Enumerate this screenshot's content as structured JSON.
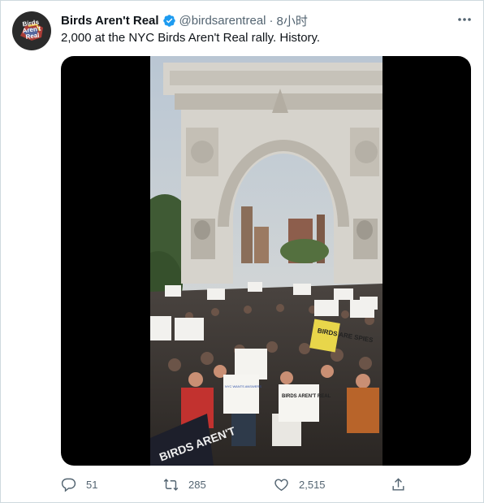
{
  "avatar": {
    "logo_text": [
      "Birds",
      "Aren't",
      "Real"
    ]
  },
  "tweet": {
    "display_name": "Birds Aren't Real",
    "handle": "@birdsarentreal",
    "separator": "·",
    "time": "8小时",
    "text": "2,000 at the NYC Birds Aren't Real rally. History."
  },
  "media": {
    "signs": [
      "BIRDS ARE SPIES",
      "BIRDS AREN'T REAL",
      "NYC WANTS ANSWERS",
      "BIRDS AREN'T"
    ]
  },
  "actions": {
    "replies": "51",
    "retweets": "285",
    "likes": "2,515"
  },
  "icons": {
    "verified": "verified-badge-icon",
    "more": "more-dots-icon",
    "reply": "reply-icon",
    "retweet": "retweet-icon",
    "like": "heart-icon",
    "share": "share-icon"
  },
  "colors": {
    "verified": "#1d9bf0",
    "secondary_text": "#536471"
  }
}
